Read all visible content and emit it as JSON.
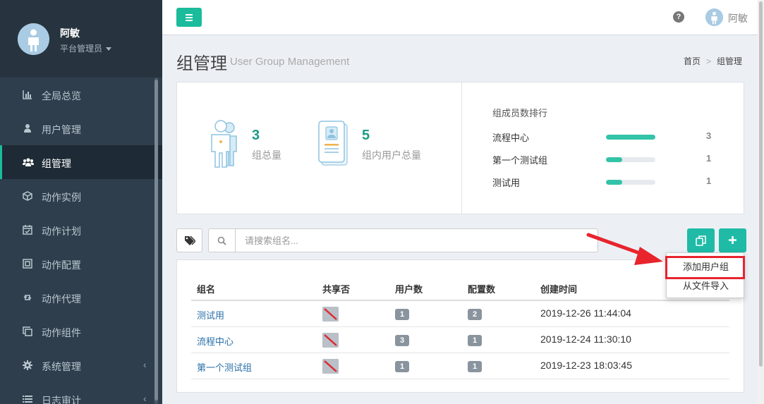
{
  "user": {
    "name": "阿敏",
    "role": "平台管理员"
  },
  "sidebar": {
    "items": [
      {
        "label": "全局总览",
        "icon": "bar-chart-icon",
        "active": false,
        "chevron": false
      },
      {
        "label": "用户管理",
        "icon": "user-icon",
        "active": false,
        "chevron": false
      },
      {
        "label": "组管理",
        "icon": "users-icon",
        "active": true,
        "chevron": false
      },
      {
        "label": "动作实例",
        "icon": "cube-icon",
        "active": false,
        "chevron": false
      },
      {
        "label": "动作计划",
        "icon": "calendar-check-icon",
        "active": false,
        "chevron": false
      },
      {
        "label": "动作配置",
        "icon": "object-group-icon",
        "active": false,
        "chevron": false
      },
      {
        "label": "动作代理",
        "icon": "retweet-icon",
        "active": false,
        "chevron": false
      },
      {
        "label": "动作组件",
        "icon": "clone-icon",
        "active": false,
        "chevron": false
      },
      {
        "label": "系统管理",
        "icon": "cog-icon",
        "active": false,
        "chevron": true
      },
      {
        "label": "日志审计",
        "icon": "list-icon",
        "active": false,
        "chevron": true
      }
    ]
  },
  "topbar": {
    "user_name": "阿敏",
    "help_glyph": "?"
  },
  "page": {
    "title": "组管理",
    "subtitle": "User Group Management",
    "breadcrumb": [
      "首页",
      "组管理"
    ],
    "breadcrumb_sep": ">"
  },
  "stats": {
    "group_total": {
      "value": "3",
      "label": "组总量"
    },
    "user_total": {
      "value": "5",
      "label": "组内用户总量"
    },
    "ranking_title": "组成员数排行",
    "ranking": [
      {
        "name": "流程中心",
        "count": "3",
        "fraction": 1.0
      },
      {
        "name": "第一个测试组",
        "count": "1",
        "fraction": 0.33
      },
      {
        "name": "测试用",
        "count": "1",
        "fraction": 0.33
      }
    ]
  },
  "toolbar": {
    "search_placeholder": "请搜索组名..."
  },
  "dropdown": {
    "items": [
      "添加用户组",
      "从文件导入"
    ]
  },
  "table": {
    "headers": [
      "组名",
      "共享否",
      "用户数",
      "配置数",
      "创建时间"
    ],
    "rows": [
      {
        "name": "测试用",
        "shared": false,
        "users": "1",
        "configs": "2",
        "created": "2019-12-26 11:44:04"
      },
      {
        "name": "流程中心",
        "shared": false,
        "users": "3",
        "configs": "1",
        "created": "2019-12-24 11:30:10"
      },
      {
        "name": "第一个测试组",
        "shared": false,
        "users": "1",
        "configs": "1",
        "created": "2019-12-23 18:03:45"
      }
    ]
  },
  "colors": {
    "accent": "#1abc9c",
    "sidebar_bg": "#2f3e4d",
    "link": "#2a6fa8",
    "highlight": "#e8242d"
  }
}
